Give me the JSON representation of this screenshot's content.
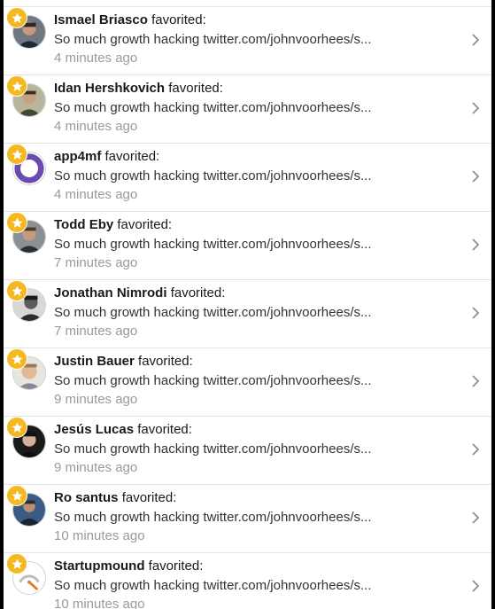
{
  "colors": {
    "badge": "#f5b820",
    "divider": "#e3e3e3",
    "timestamp": "#9a9a9a",
    "background": "#ffffff"
  },
  "notifications": [
    {
      "name": "Ismael Briasco",
      "action": "favorited:",
      "text": "So much growth hacking twitter.com/johnvoorhees/s...",
      "time": "4 minutes ago",
      "avatar": "avatar-photo-1",
      "badge_icon": "star-icon"
    },
    {
      "name": "Idan Hershkovich",
      "action": "favorited:",
      "text": "So much growth hacking twitter.com/johnvoorhees/s...",
      "time": "4 minutes ago",
      "avatar": "avatar-photo-2",
      "badge_icon": "star-icon"
    },
    {
      "name": "app4mf",
      "action": "favorited:",
      "text": "So much growth hacking twitter.com/johnvoorhees/s...",
      "time": "4 minutes ago",
      "avatar": "avatar-purple-ring",
      "badge_icon": "star-icon"
    },
    {
      "name": "Todd Eby",
      "action": "favorited:",
      "text": "So much growth hacking twitter.com/johnvoorhees/s...",
      "time": "7 minutes ago",
      "avatar": "avatar-photo-4",
      "badge_icon": "star-icon"
    },
    {
      "name": "Jonathan Nimrodi",
      "action": "favorited:",
      "text": "So much growth hacking twitter.com/johnvoorhees/s...",
      "time": "7 minutes ago",
      "avatar": "avatar-photo-5",
      "badge_icon": "star-icon"
    },
    {
      "name": "Justin Bauer",
      "action": "favorited:",
      "text": "So much growth hacking twitter.com/johnvoorhees/s...",
      "time": "9 minutes ago",
      "avatar": "avatar-photo-6",
      "badge_icon": "star-icon"
    },
    {
      "name": "Jesús Lucas",
      "action": "favorited:",
      "text": "So much growth hacking twitter.com/johnvoorhees/s...",
      "time": "9 minutes ago",
      "avatar": "avatar-photo-7",
      "badge_icon": "star-icon"
    },
    {
      "name": "Ro santus",
      "action": "favorited:",
      "text": "So much growth hacking twitter.com/johnvoorhees/s...",
      "time": "10 minutes ago",
      "avatar": "avatar-photo-8",
      "badge_icon": "star-icon"
    },
    {
      "name": "Startupmound",
      "action": "favorited:",
      "text": "So much growth hacking twitter.com/johnvoorhees/s...",
      "time": "10 minutes ago",
      "avatar": "avatar-gauge-logo",
      "badge_icon": "star-icon"
    }
  ]
}
